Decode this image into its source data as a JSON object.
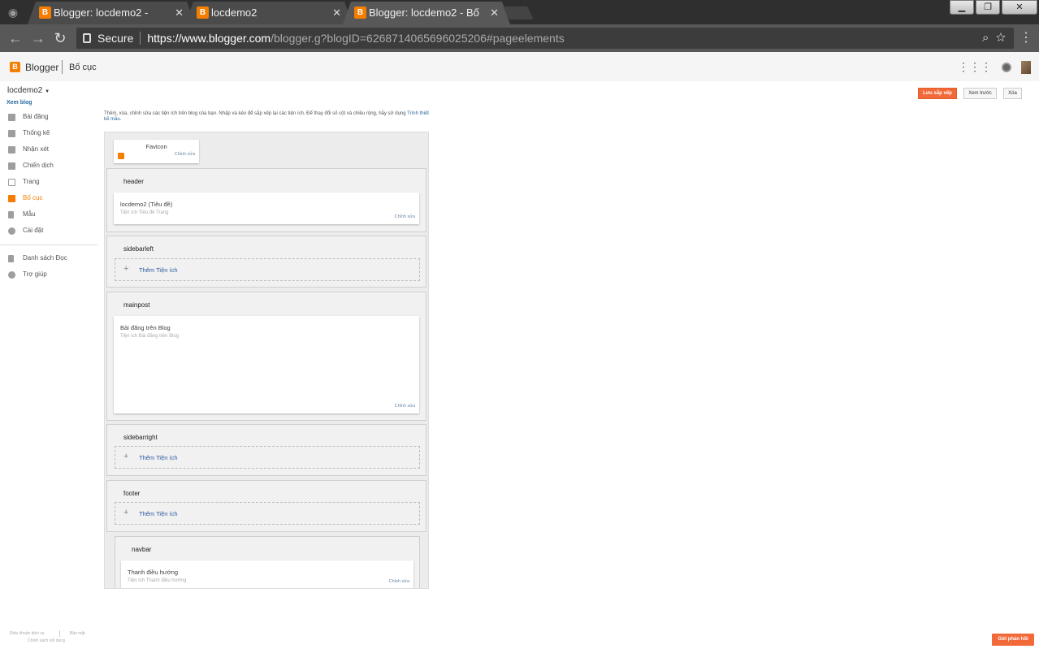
{
  "browser": {
    "tabs": [
      {
        "title": "Blogger: locdemo2 -",
        "close": "✕"
      },
      {
        "title": "locdemo2",
        "close": "✕"
      },
      {
        "title": "Blogger: locdemo2 - Bố",
        "close": "✕"
      }
    ],
    "secure_label": "Secure",
    "url_host": "https://www.blogger.com",
    "url_rest": "/blogger.g?blogID=6268714065696025206#pageelements"
  },
  "app": {
    "brand": "Blogger",
    "page_title": "Bố cục"
  },
  "sidebar": {
    "blog_name": "locdemo2",
    "view_blog": "Xem blog",
    "items": [
      {
        "label": "Bài đăng",
        "icon": "posts-icon"
      },
      {
        "label": "Thống kê",
        "icon": "stats-icon"
      },
      {
        "label": "Nhận xét",
        "icon": "comments-icon"
      },
      {
        "label": "Chiến dịch",
        "icon": "campaign-icon"
      },
      {
        "label": "Trang",
        "icon": "pages-icon"
      },
      {
        "label": "Bố cục",
        "icon": "layout-icon",
        "active": true
      },
      {
        "label": "Mẫu",
        "icon": "theme-icon"
      },
      {
        "label": "Cài đặt",
        "icon": "settings-icon"
      }
    ],
    "extra_items": [
      {
        "label": "Danh sách Đọc",
        "icon": "bookmark-icon"
      },
      {
        "label": "Trợ giúp",
        "icon": "help-icon"
      }
    ]
  },
  "actions": {
    "save": "Lưu sắp xếp",
    "preview": "Xem trước",
    "clear": "Xóa"
  },
  "intro": {
    "text": "Thêm, xóa, chỉnh sửa các tiện ích trên blog của bạn. Nhấp và kéo để sắp xếp lại các tiện ích. Để thay đổi số cột và chiều rộng, hãy sử dụng",
    "link": "Trình thiết kế mẫu."
  },
  "layout": {
    "favicon": {
      "title": "Favicon",
      "edit": "Chỉnh sửa"
    },
    "header": {
      "title": "header",
      "widget_title": "locdemo2 (Tiêu đề)",
      "widget_sub": "Tiện ích Tiêu đề Trang",
      "edit": "Chỉnh sửa"
    },
    "sidebarleft": {
      "title": "sidebarleft",
      "add": "Thêm Tiện ích"
    },
    "mainpost": {
      "title": "mainpost",
      "widget_title": "Bài đăng trên Blog",
      "widget_sub": "Tiện ích Bài đăng trên Blog",
      "edit": "Chỉnh sửa"
    },
    "sidebarright": {
      "title": "sidebarright",
      "add": "Thêm Tiện ích"
    },
    "footer": {
      "title": "footer",
      "add": "Thêm Tiện ích"
    },
    "navbar": {
      "title": "navbar",
      "widget_title": "Thanh điều hướng",
      "widget_sub": "Tiện ích Thanh điều hướng",
      "edit": "Chỉnh sửa"
    }
  },
  "footer": {
    "terms": "Điều khoản dịch vụ",
    "privacy": "Bảo mật",
    "content_policy": "Chính sách nội dung",
    "feedback": "Gửi phản hồi"
  }
}
